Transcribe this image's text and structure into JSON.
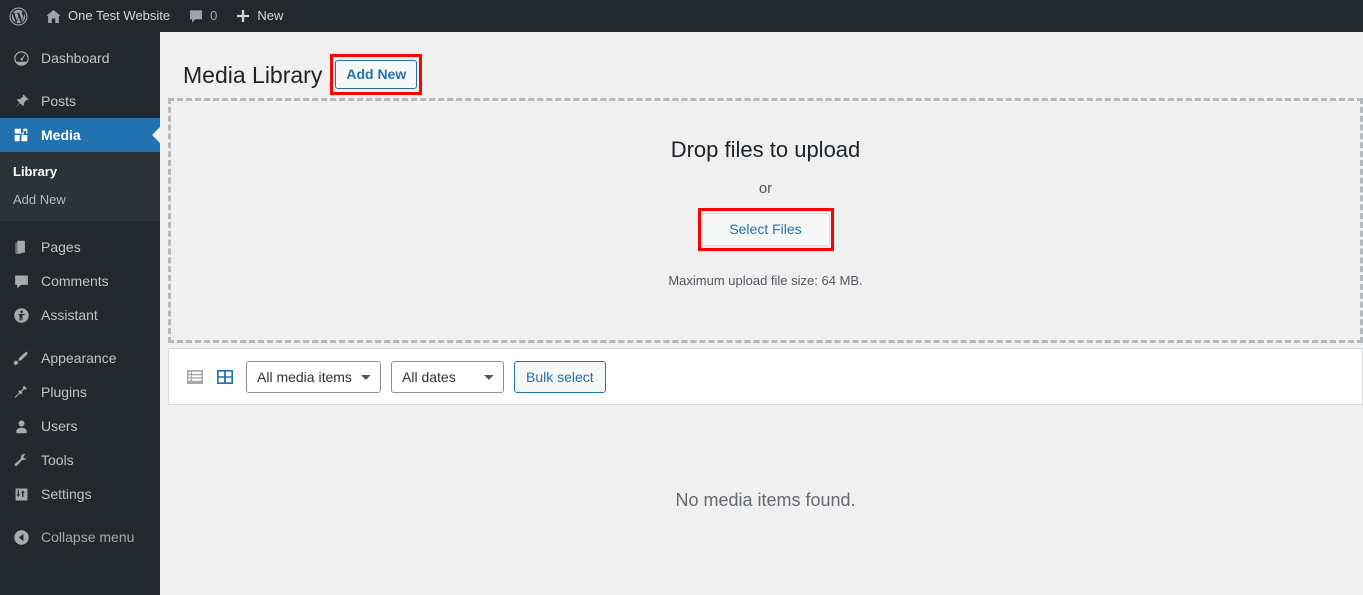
{
  "adminbar": {
    "logo_icon": "wordpress-logo-icon",
    "site_home_icon": "home-icon",
    "site_name": "One Test Website",
    "comments_icon": "comment-bubble-icon",
    "comments_count": "0",
    "new_icon": "plus-icon",
    "new_label": "New"
  },
  "sidebar": {
    "items": [
      {
        "label": "Dashboard",
        "icon": "dashboard-icon",
        "current": false
      },
      {
        "label": "Posts",
        "icon": "pin-icon",
        "current": false
      },
      {
        "label": "Media",
        "icon": "media-icon",
        "current": true
      },
      {
        "label": "Pages",
        "icon": "pages-icon",
        "current": false
      },
      {
        "label": "Comments",
        "icon": "comment-bubble-icon",
        "current": false
      },
      {
        "label": "Assistant",
        "icon": "assistant-person-icon",
        "current": false
      },
      {
        "label": "Appearance",
        "icon": "paintbrush-icon",
        "current": false
      },
      {
        "label": "Plugins",
        "icon": "plug-icon",
        "current": false
      },
      {
        "label": "Users",
        "icon": "user-icon",
        "current": false
      },
      {
        "label": "Tools",
        "icon": "wrench-icon",
        "current": false
      },
      {
        "label": "Settings",
        "icon": "sliders-icon",
        "current": false
      }
    ],
    "submenu": [
      {
        "label": "Library",
        "current": true
      },
      {
        "label": "Add New",
        "current": false
      }
    ],
    "collapse": {
      "label": "Collapse menu",
      "icon": "collapse-arrow-left-icon"
    }
  },
  "page": {
    "title": "Media Library",
    "add_new_label": "Add New"
  },
  "dropzone": {
    "title": "Drop files to upload",
    "or": "or",
    "select_files_label": "Select Files",
    "max_upload": "Maximum upload file size: 64 MB."
  },
  "toolbar": {
    "list_view_icon": "list-view-icon",
    "grid_view_icon": "grid-view-icon",
    "media_type_selected": "All media items",
    "media_type_options": [
      "All media items"
    ],
    "date_selected": "All dates",
    "date_options": [
      "All dates"
    ],
    "bulk_select_label": "Bulk select"
  },
  "empty_state": {
    "message": "No media items found."
  },
  "colors": {
    "admin_bar_bg": "#23282d",
    "sidebar_bg": "#23282d",
    "submenu_bg": "#2c3338",
    "active_blue": "#2271b1",
    "content_bg": "#f0f0f1",
    "highlight_red": "#ff0000",
    "dashed_border": "#b4b9be"
  }
}
